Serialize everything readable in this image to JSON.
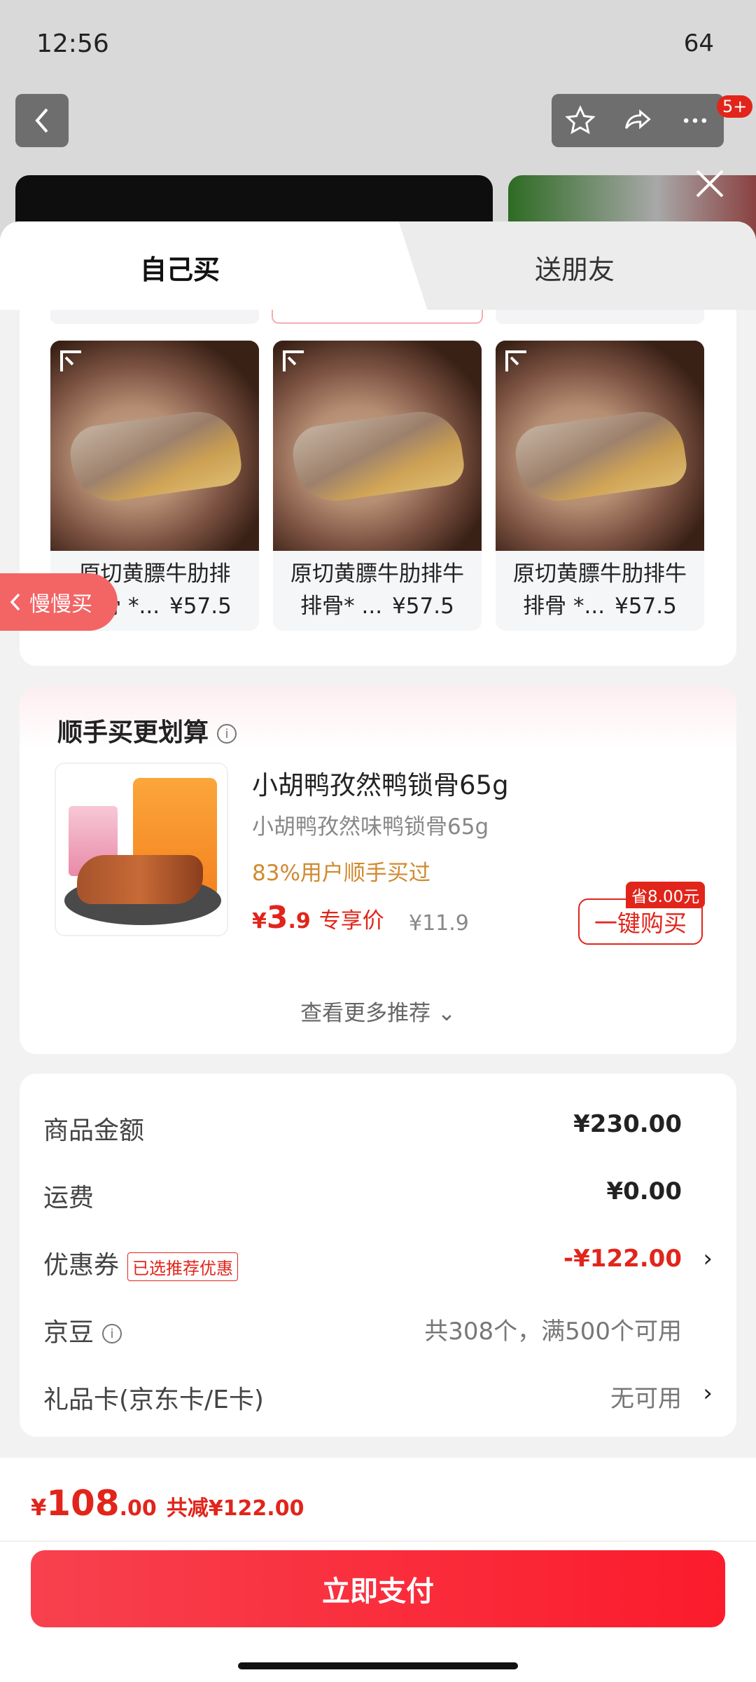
{
  "status_bar": {
    "time": "12:56",
    "battery": "64"
  },
  "nav": {
    "badge": "5+"
  },
  "tabs": {
    "self": "自己买",
    "gift": "送朋友"
  },
  "products": [
    {
      "name_line1": "原切黄膘牛肋排",
      "name_line2": "排骨 *...",
      "price": "¥57.5"
    },
    {
      "name_line1": "原切黄膘牛肋排牛",
      "name_line2": "排骨* ...",
      "price": "¥57.5"
    },
    {
      "name_line1": "原切黄膘牛肋排牛",
      "name_line2": "排骨 *...",
      "price": "¥57.5"
    }
  ],
  "slow_buy": {
    "label": "慢慢买"
  },
  "addon": {
    "section_title": "顺手买更划算",
    "name": "小胡鸭孜然鸭锁骨65g",
    "subtitle": "小胡鸭孜然味鸭锁骨65g",
    "rate": "83%用户顺手买过",
    "price_symbol": "¥",
    "price_int": "3",
    "price_dec": ".9",
    "price_tag": "专享价",
    "orig_price": "¥11.9",
    "save_tag": "省8.00元",
    "buy_label": "一键购买",
    "more": "查看更多推荐"
  },
  "summary": {
    "goods_label": "商品金额",
    "goods_value": "¥230.00",
    "ship_label": "运费",
    "ship_value": "¥0.00",
    "coupon_label": "优惠券",
    "coupon_tag": "已选推荐优惠",
    "coupon_value": "-¥122.00",
    "bean_label": "京豆",
    "bean_value": "共308个，满500个可用",
    "gift_label": "礼品卡(京东卡/E卡)",
    "gift_value": "无可用"
  },
  "bottom": {
    "total_symbol": "¥",
    "total_int": "108",
    "total_dec": ".00",
    "discount": "共减¥122.00",
    "pay_label": "立即支付"
  }
}
